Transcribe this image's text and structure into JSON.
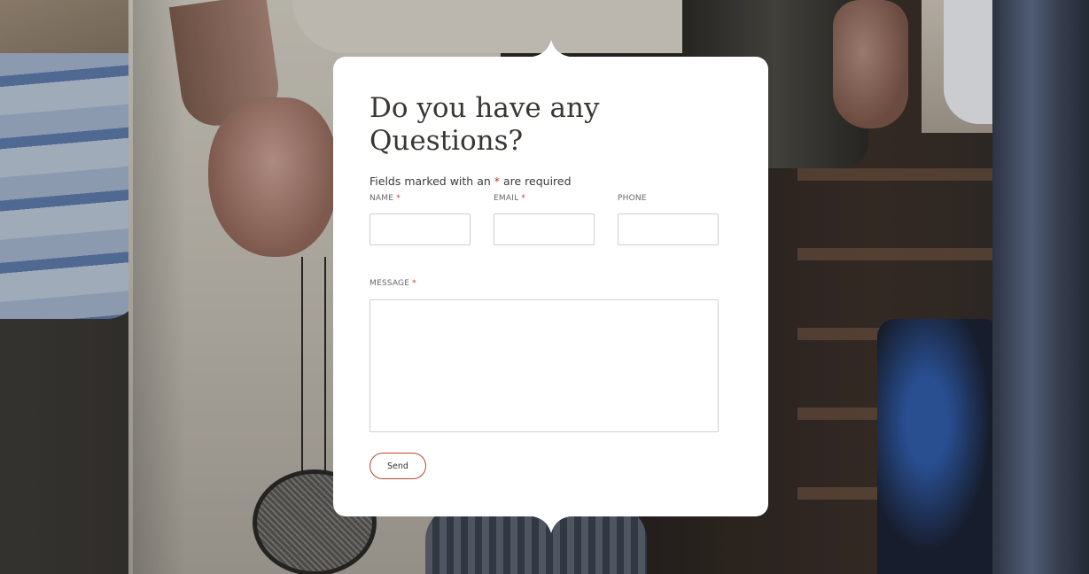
{
  "form": {
    "title_line1": "Do you have any",
    "title_line2": "Questions?",
    "required_note_prefix": "Fields marked with an ",
    "required_star": "*",
    "required_note_suffix": " are required",
    "fields": {
      "name_label": "NAME",
      "email_label": "EMAIL",
      "phone_label": "PHONE",
      "message_label": "MESSAGE",
      "required_marker": "*",
      "name_value": "",
      "email_value": "",
      "phone_value": "",
      "message_value": ""
    },
    "send_label": "Send"
  },
  "colors": {
    "accent": "#b3462f",
    "required": "#c0392b",
    "card_bg": "#ffffff"
  }
}
